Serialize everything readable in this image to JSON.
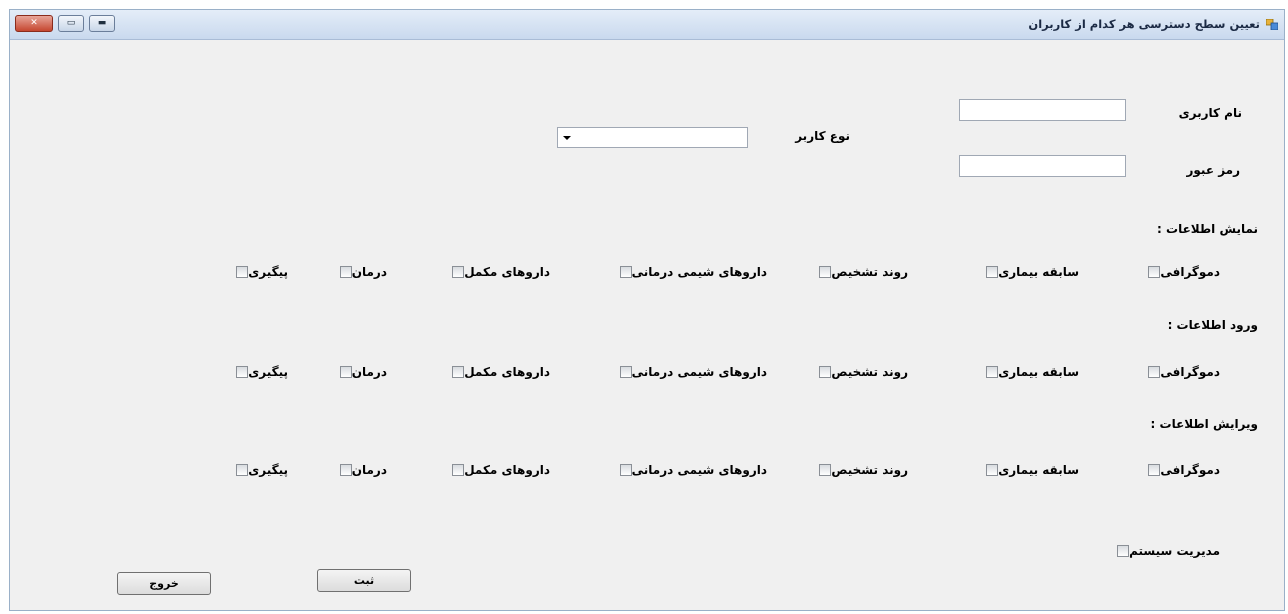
{
  "window": {
    "title": "تعیین سطح دسترسی هر کدام از کاربران",
    "close_glyph": "✕",
    "max_glyph": "▭",
    "min_glyph": "▬"
  },
  "form": {
    "username_label": "نام کاربری",
    "password_label": "رمز عبور",
    "user_type_label": "نوع کاربر",
    "username_value": "",
    "password_value": "",
    "user_type_selected": ""
  },
  "sections": {
    "view_label": "نمایش اطلاعات :",
    "entry_label": "ورود اطلاعات :",
    "edit_label": "ویرایش اطلاعات :"
  },
  "options": [
    "دموگرافی",
    "سابقه بیماری",
    "روند تشخیص",
    "داروهای شیمی درمانی",
    "داروهای مکمل",
    "درمان",
    "پیگیری"
  ],
  "system_admin_label": "مدیریت سیستم",
  "buttons": {
    "submit_label": "ثبت",
    "exit_label": "خروج"
  }
}
